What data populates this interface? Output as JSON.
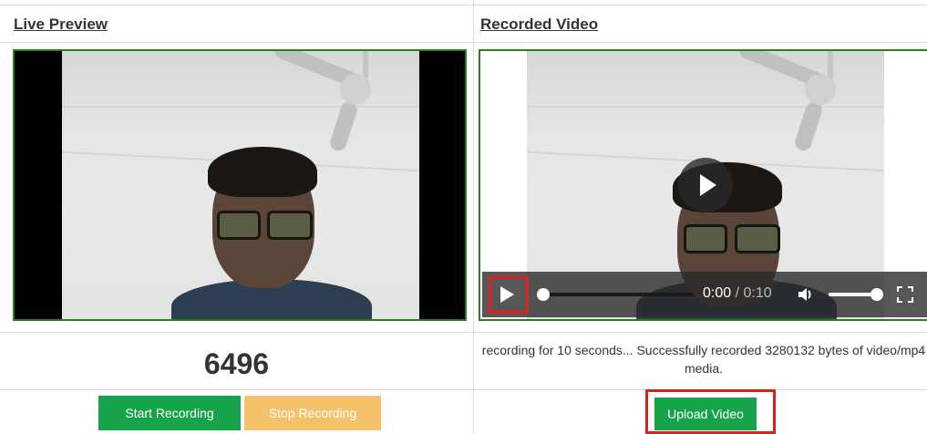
{
  "live_preview": {
    "heading": "Live Preview",
    "counter": "6496",
    "start_label": "Start Recording",
    "stop_label": "Stop Recording"
  },
  "recorded_video": {
    "heading": "Recorded Video",
    "time_current": "0:00",
    "time_separator": " / ",
    "time_total": "0:10",
    "progress": 0,
    "volume": 1.0,
    "status_text": "recording for 10 seconds... Successfully recorded 3280132 bytes of video/mp4 media.",
    "upload_label": "Upload Video"
  },
  "colors": {
    "frame_border": "#2e7d20",
    "start_button": "#17a34a",
    "stop_button": "#f5c26b",
    "upload_button": "#17a34a",
    "highlight": "#e02020"
  },
  "icons": {
    "play": "play-icon",
    "volume": "volume-icon",
    "fullscreen": "fullscreen-icon"
  }
}
